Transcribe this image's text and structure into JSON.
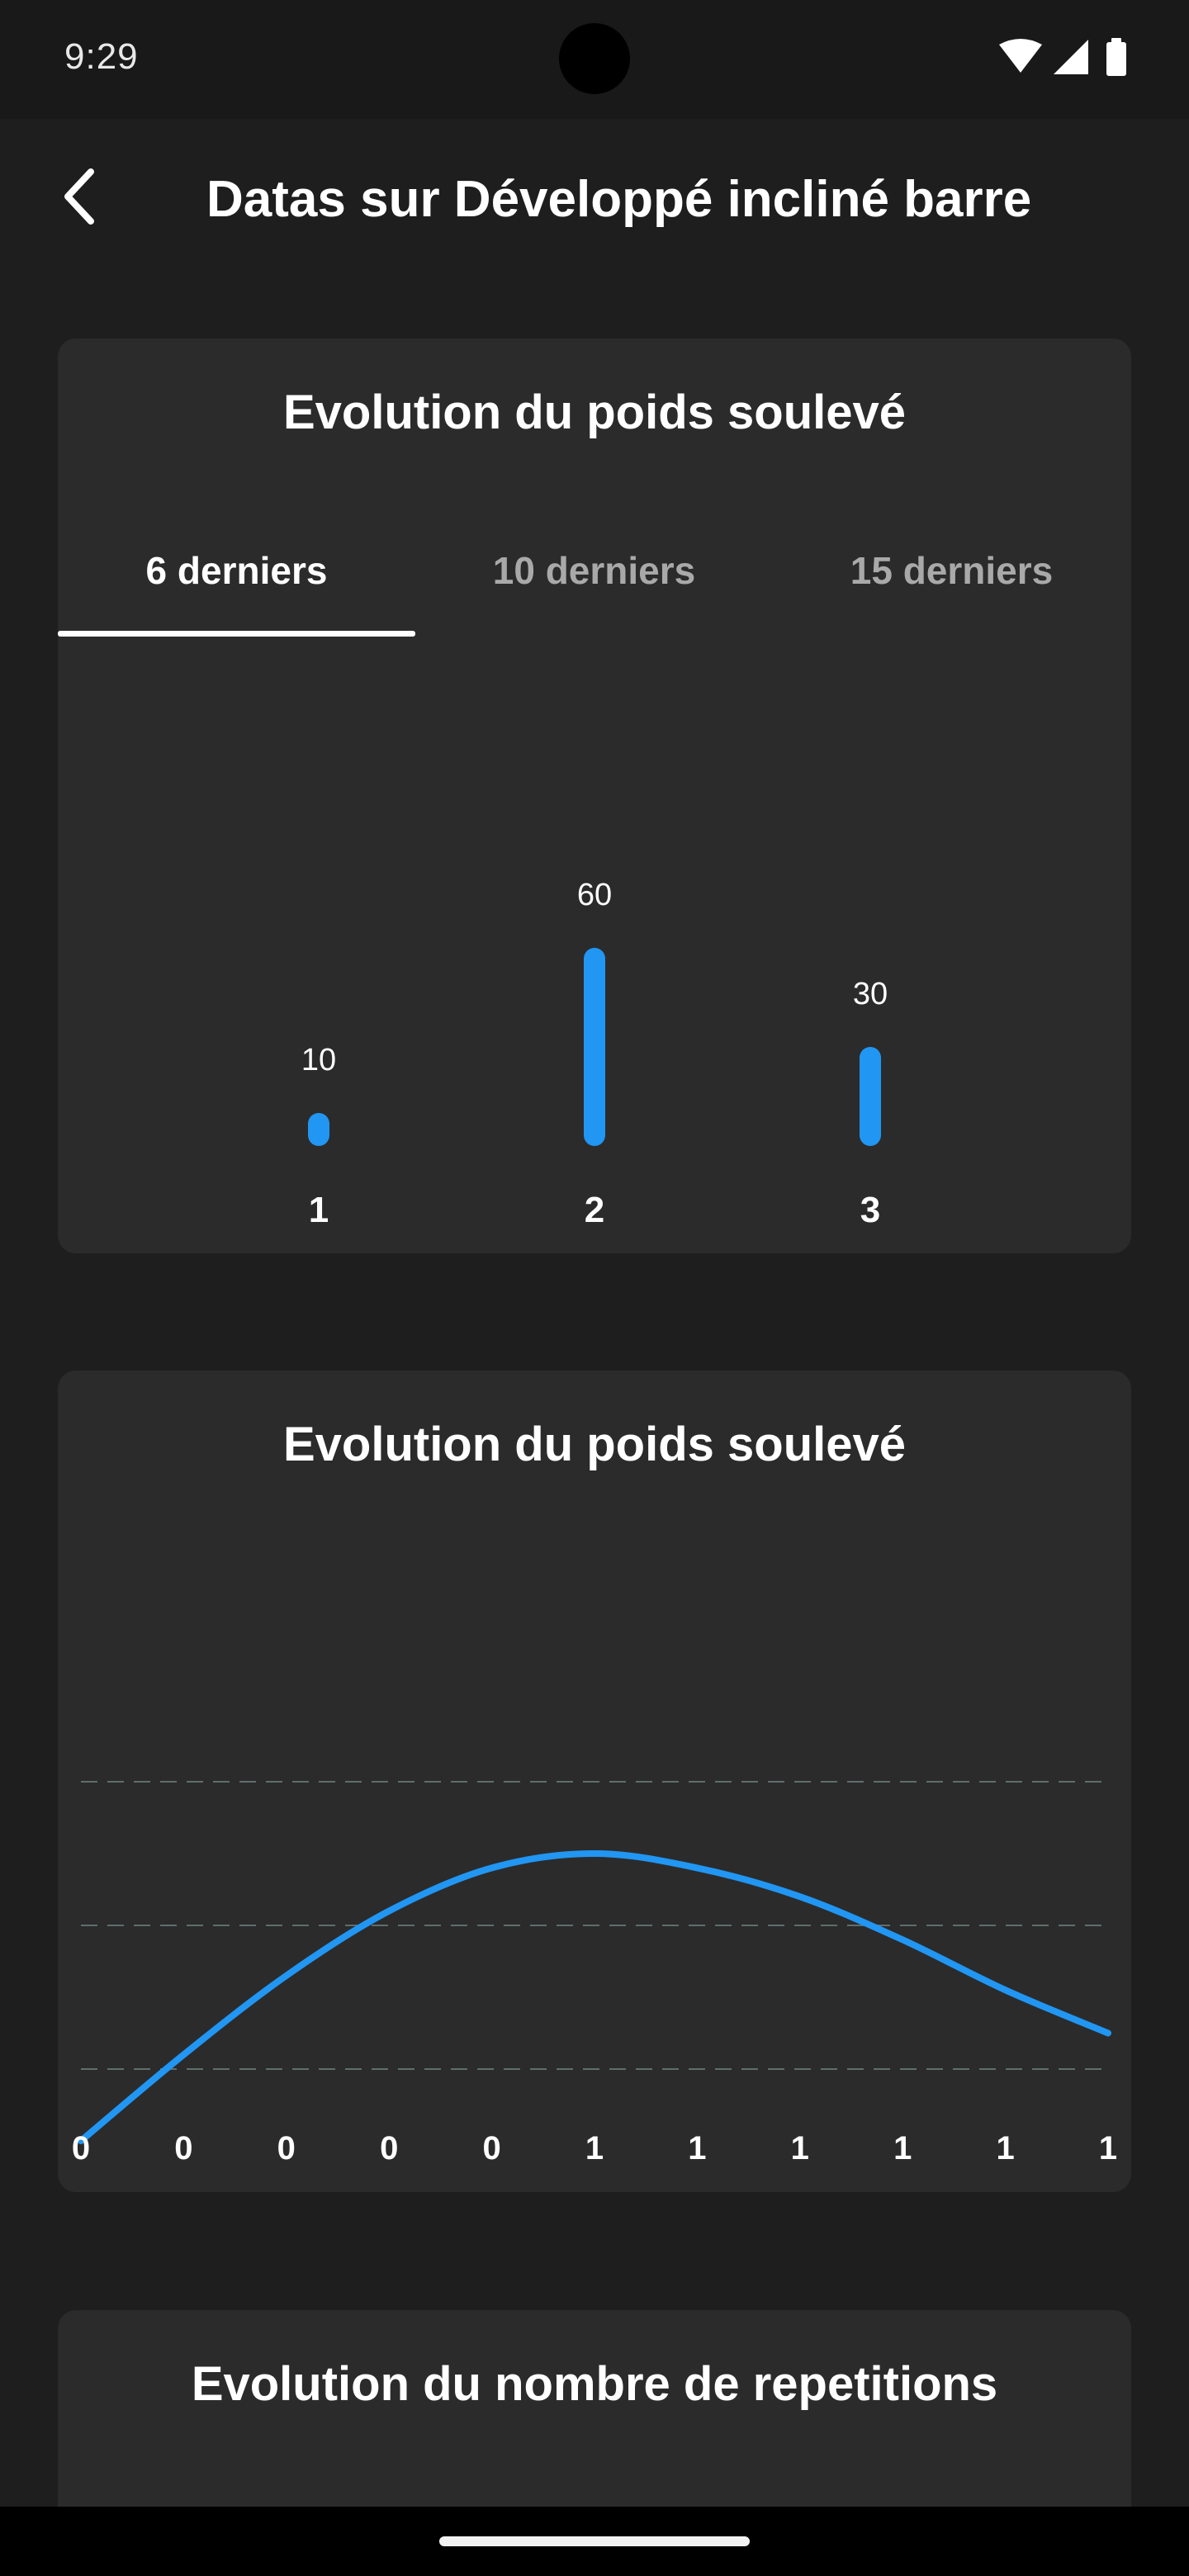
{
  "status_bar": {
    "time": "9:29",
    "icons": [
      "wifi-icon",
      "cellular-signal-icon",
      "battery-icon"
    ]
  },
  "app_bar": {
    "back_icon": "chevron-left-icon",
    "title": "Datas sur Développé incliné barre"
  },
  "weight_card": {
    "title": "Evolution du poids soulevé",
    "tabs": [
      {
        "label": "6 derniers",
        "active": true
      },
      {
        "label": "10 derniers",
        "active": false
      },
      {
        "label": "15 derniers",
        "active": false
      }
    ]
  },
  "line_card": {
    "title": "Evolution du poids soulevé"
  },
  "reps_card": {
    "title": "Evolution du nombre de repetitions"
  },
  "colors": {
    "accent": "#2196F3",
    "background": "#1e1e1e",
    "card": "#2b2b2b",
    "grid": "#5f6e6c"
  },
  "chart_data": [
    {
      "type": "bar",
      "title": "Evolution du poids soulevé",
      "categories": [
        "1",
        "2",
        "3"
      ],
      "values": [
        10,
        60,
        30
      ],
      "data_labels": [
        "10",
        "60",
        "30"
      ],
      "ylim": [
        0,
        60
      ],
      "grid": false
    },
    {
      "type": "line",
      "title": "Evolution du poids soulevé",
      "x_tick_labels": [
        "0",
        "0",
        "0",
        "0",
        "0",
        "1",
        "1",
        "1",
        "1",
        "1",
        "1"
      ],
      "x": [
        0,
        0.1,
        0.2,
        0.3,
        0.4,
        0.5,
        0.6,
        0.7,
        0.8,
        0.9,
        1.0
      ],
      "values": [
        10,
        22,
        33,
        42,
        48,
        50,
        48,
        44,
        38,
        31,
        25
      ],
      "ylim": [
        0,
        60
      ],
      "gridlines_y": [
        20,
        40,
        60
      ],
      "grid": "horizontal-dashed",
      "smooth": true
    }
  ]
}
